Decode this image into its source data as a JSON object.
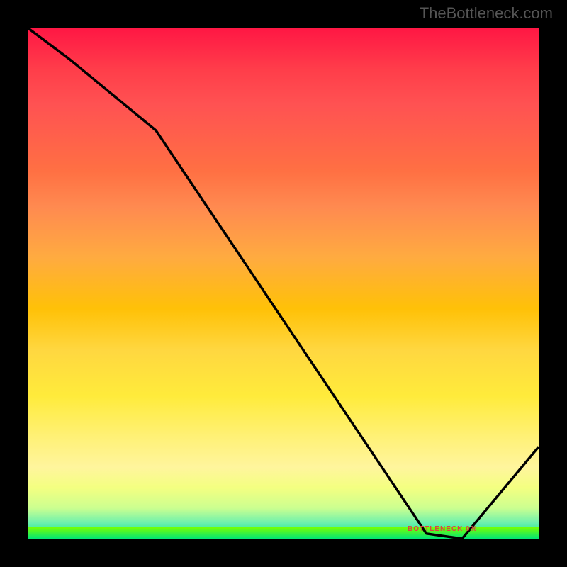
{
  "watermark": "TheBottleneck.com",
  "annotation_label": "BOTTLENECK 0%",
  "chart_data": {
    "type": "line",
    "title": "",
    "xlabel": "",
    "ylabel": "",
    "xlim": [
      0,
      100
    ],
    "ylim": [
      0,
      100
    ],
    "x": [
      0,
      8,
      25,
      78,
      85,
      100
    ],
    "values": [
      100,
      94,
      80,
      1,
      0,
      18
    ],
    "gradient_stops": [
      {
        "pos": 0,
        "color": "#ff1744"
      },
      {
        "pos": 50,
        "color": "#ffc107"
      },
      {
        "pos": 90,
        "color": "#f4ff81"
      },
      {
        "pos": 100,
        "color": "#00e676"
      }
    ],
    "annotation": {
      "x": 82,
      "y": 1,
      "text": "BOTTLENECK 0%"
    }
  }
}
